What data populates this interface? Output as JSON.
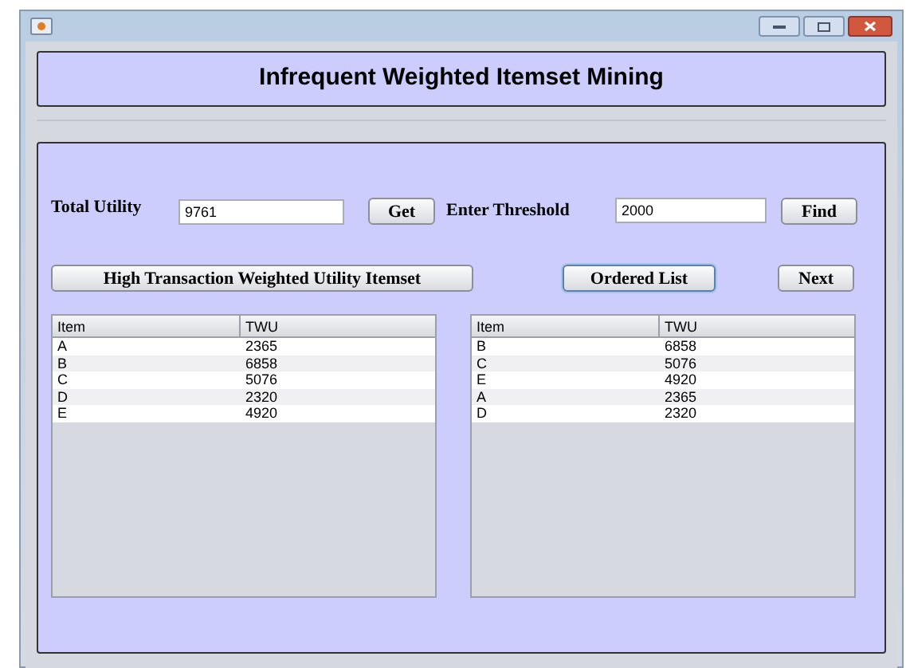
{
  "header": {
    "title": "Infrequent Weighted Itemset Mining"
  },
  "total_utility": {
    "label": "Total Utility",
    "value": "9761"
  },
  "get_button": "Get",
  "threshold": {
    "label": "Enter Threshold",
    "value": "2000"
  },
  "find_button": "Find",
  "htwui_button": "High Transaction Weighted Utility Itemset",
  "ordered_list_button": {
    "label": "Ordered List",
    "selected": true
  },
  "next_button": "Next",
  "tables": [
    {
      "columns": [
        "Item",
        "TWU"
      ],
      "rows": [
        [
          "A",
          "2365"
        ],
        [
          "B",
          "6858"
        ],
        [
          "C",
          "5076"
        ],
        [
          "D",
          "2320"
        ],
        [
          "E",
          "4920"
        ]
      ]
    },
    {
      "columns": [
        "Item",
        "TWU"
      ],
      "rows": [
        [
          "B",
          "6858"
        ],
        [
          "C",
          "5076"
        ],
        [
          "E",
          "4920"
        ],
        [
          "A",
          "2365"
        ],
        [
          "D",
          "2320"
        ]
      ]
    }
  ]
}
